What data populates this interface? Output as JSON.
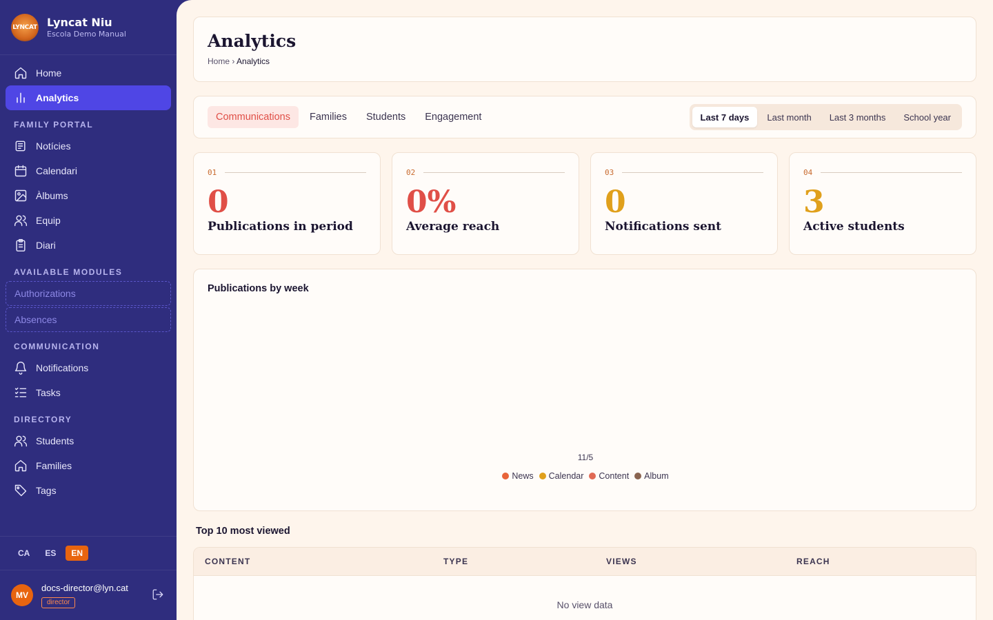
{
  "brand": {
    "name": "Lyncat Niu",
    "subtitle": "Escola Demo Manual",
    "logo_text": "LYNCAT"
  },
  "nav": {
    "home": "Home",
    "analytics": "Analytics",
    "family_portal_title": "FAMILY PORTAL",
    "family_portal": [
      {
        "label": "Notícies",
        "icon": "newspaper-icon"
      },
      {
        "label": "Calendari",
        "icon": "calendar-icon"
      },
      {
        "label": "Àlbums",
        "icon": "image-icon"
      },
      {
        "label": "Equip",
        "icon": "users-icon"
      },
      {
        "label": "Diari",
        "icon": "clipboard-icon"
      }
    ],
    "modules_title": "AVAILABLE MODULES",
    "modules": [
      "Authorizations",
      "Absences"
    ],
    "communication_title": "COMMUNICATION",
    "communication": [
      {
        "label": "Notifications",
        "icon": "bell-icon"
      },
      {
        "label": "Tasks",
        "icon": "list-check-icon"
      }
    ],
    "directory_title": "DIRECTORY",
    "directory": [
      {
        "label": "Students",
        "icon": "users-icon"
      },
      {
        "label": "Families",
        "icon": "home-icon"
      },
      {
        "label": "Tags",
        "icon": "tag-icon"
      }
    ]
  },
  "languages": {
    "ca": "CA",
    "es": "ES",
    "en": "EN",
    "active": "EN"
  },
  "user": {
    "initials": "MV",
    "email": "docs-director@lyn.cat",
    "role": "director"
  },
  "page": {
    "title": "Analytics",
    "breadcrumb_home": "Home",
    "breadcrumb_sep": "›",
    "breadcrumb_current": "Analytics"
  },
  "tabs": [
    "Communications",
    "Families",
    "Students",
    "Engagement"
  ],
  "active_tab": "Communications",
  "ranges": [
    "Last 7 days",
    "Last month",
    "Last 3 months",
    "School year"
  ],
  "active_range": "Last 7 days",
  "stats": [
    {
      "num": "01",
      "value": "0",
      "label": "Publications in period",
      "color": "#e04f47"
    },
    {
      "num": "02",
      "value": "0%",
      "label": "Average reach",
      "color": "#e04f47"
    },
    {
      "num": "03",
      "value": "0",
      "label": "Notifications sent",
      "color": "#e0a01c"
    },
    {
      "num": "04",
      "value": "3",
      "label": "Active students",
      "color": "#e0a01c"
    }
  ],
  "chart_title": "Publications by week",
  "chart_data": {
    "type": "bar",
    "categories": [
      "11/5"
    ],
    "series": [
      {
        "name": "News",
        "values": [
          0
        ],
        "color": "#e8643a"
      },
      {
        "name": "Calendar",
        "values": [
          0
        ],
        "color": "#e0a01c"
      },
      {
        "name": "Content",
        "values": [
          0
        ],
        "color": "#e06a55"
      },
      {
        "name": "Album",
        "values": [
          0
        ],
        "color": "#8a6450"
      }
    ]
  },
  "top": {
    "title": "Top 10 most viewed",
    "columns": [
      "CONTENT",
      "TYPE",
      "VIEWS",
      "REACH"
    ],
    "empty": "No view data"
  }
}
